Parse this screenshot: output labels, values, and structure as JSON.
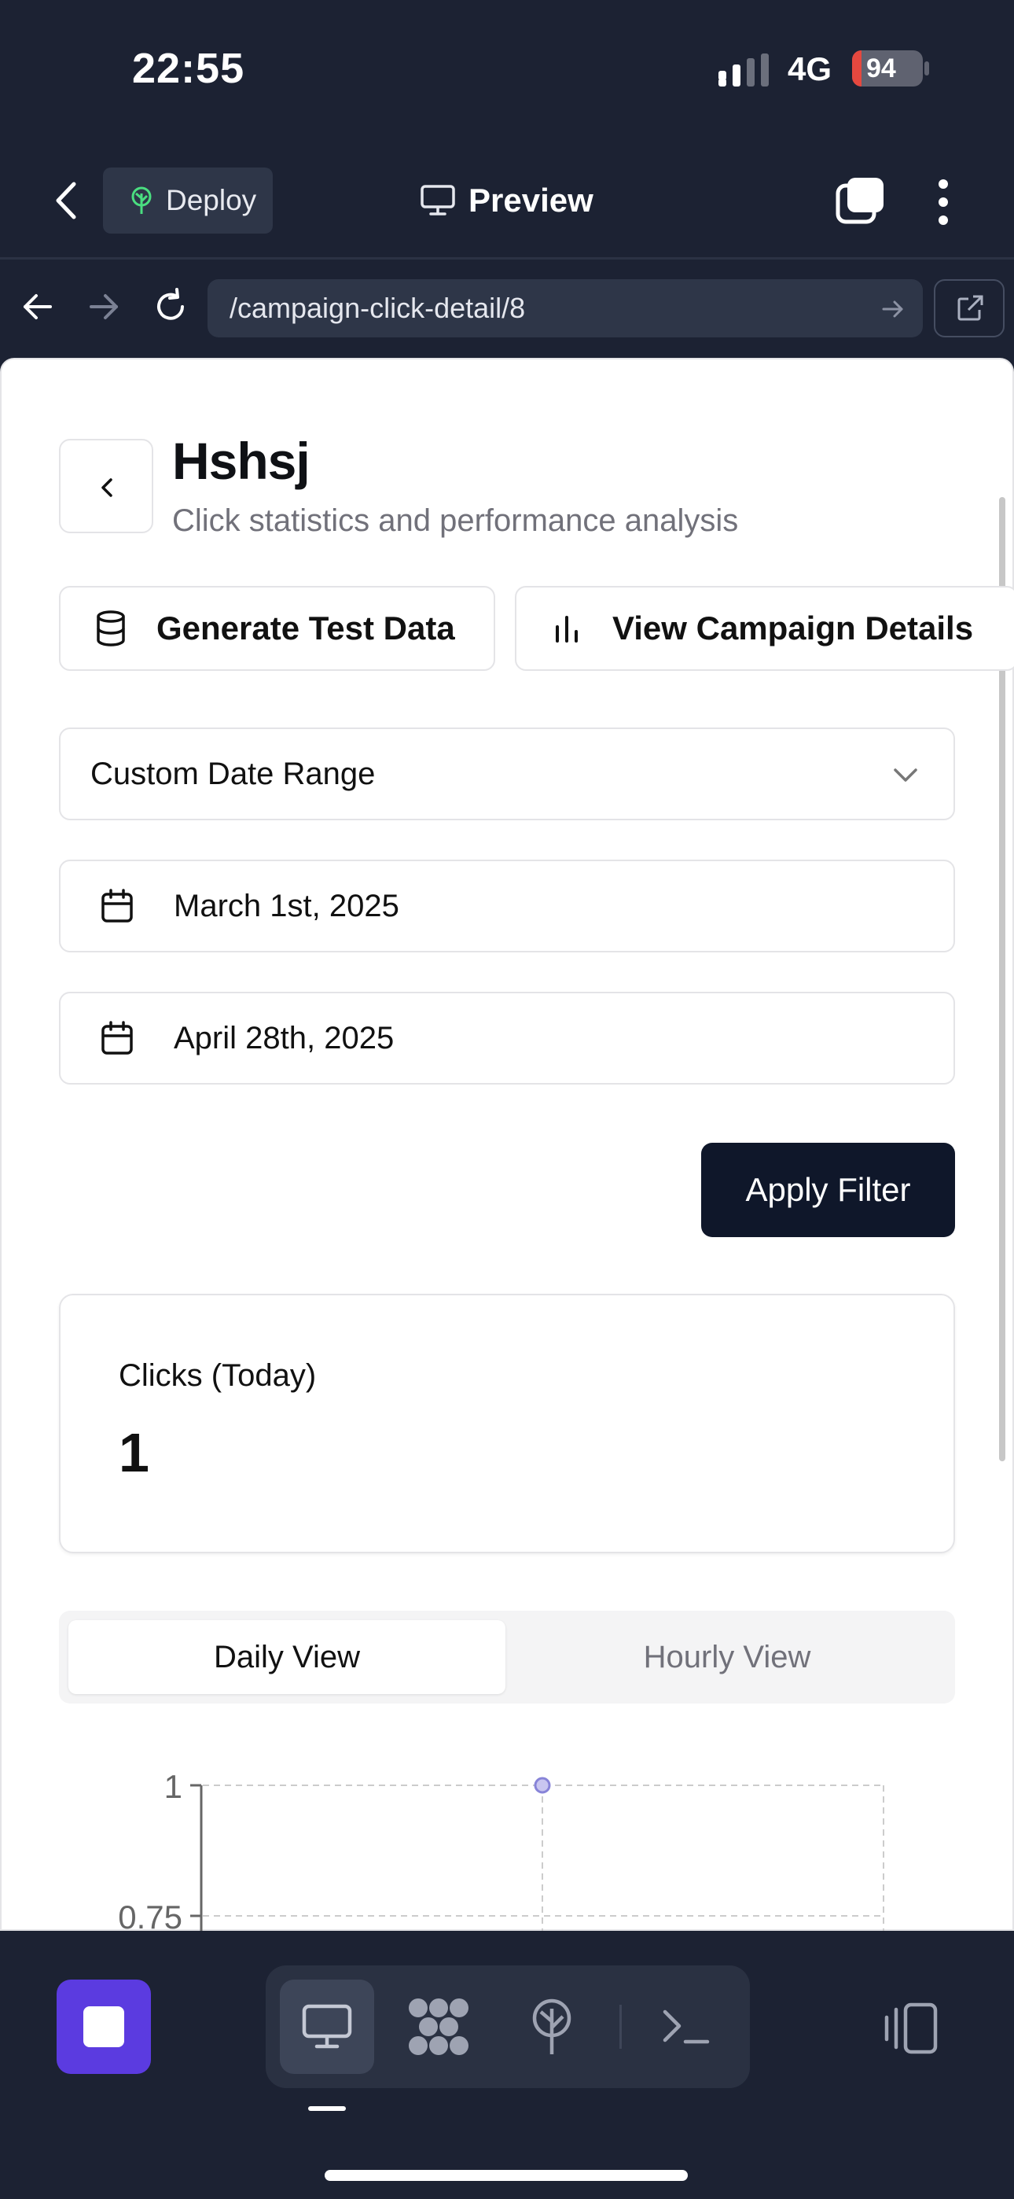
{
  "status_bar": {
    "time": "22:55",
    "network": "4G",
    "battery": "94"
  },
  "app_header": {
    "deploy_label": "Deploy",
    "preview_label": "Preview"
  },
  "browser": {
    "url": "/campaign-click-detail/8"
  },
  "page": {
    "title": "Hshsj",
    "subtitle": "Click statistics and performance analysis",
    "buttons": {
      "generate_test_data": "Generate Test Data",
      "view_campaign_details": "View Campaign Details",
      "apply_filter": "Apply Filter"
    },
    "date_range_select": {
      "selected": "Custom Date Range"
    },
    "start_date": "March 1st, 2025",
    "end_date": "April 28th, 2025",
    "stat_card": {
      "label": "Clicks (Today)",
      "value": "1"
    },
    "view_tabs": [
      {
        "label": "Daily View",
        "active": true
      },
      {
        "label": "Hourly View",
        "active": false
      }
    ]
  },
  "chart_data": {
    "type": "line",
    "y_ticks": [
      "1",
      "0.75"
    ],
    "points": [
      {
        "x_index": 1,
        "y": 1
      }
    ],
    "grid": true,
    "point_color": "#8884d8"
  },
  "colors": {
    "primary_button": "#0f172a",
    "stop_button": "#5b3be0",
    "chrome_bg": "#1c2233"
  }
}
